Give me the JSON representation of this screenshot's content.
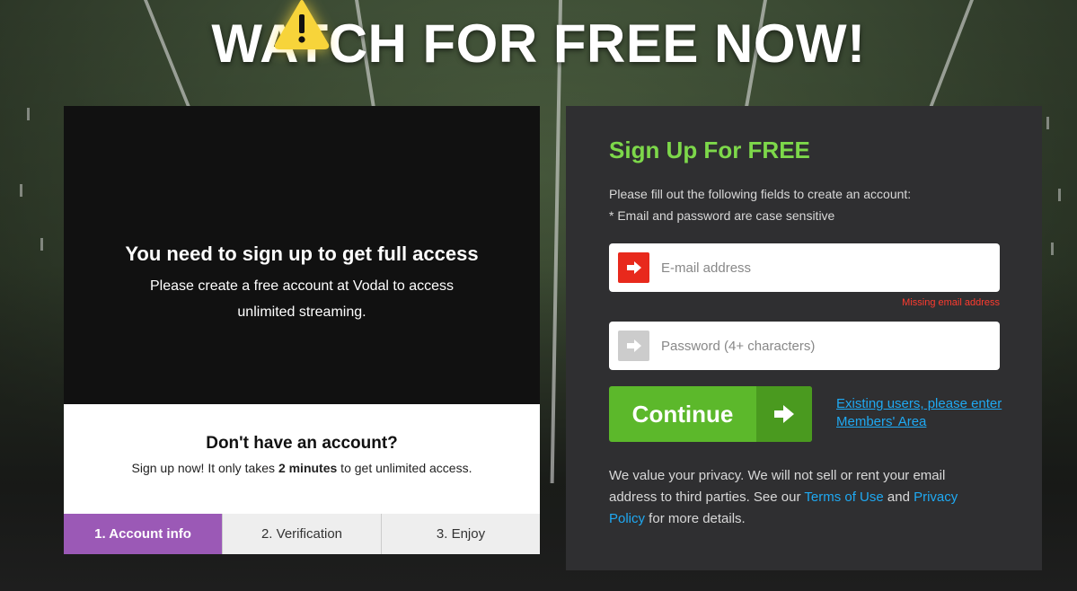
{
  "headline": "WATCH FOR FREE NOW!",
  "left_panel": {
    "warning_title": "You need to sign up to get full access",
    "warning_desc": "Please create a free account at Vodal to access unlimited streaming.",
    "no_account_title": "Don't have an account?",
    "no_account_sub_pre": "Sign up now! It only takes ",
    "no_account_sub_bold": "2 minutes",
    "no_account_sub_post": " to get unlimited access.",
    "steps": [
      "1. Account info",
      "2. Verification",
      "3. Enjoy"
    ],
    "active_step": 0
  },
  "signup": {
    "title": "Sign Up For FREE",
    "info_line1": "Please fill out the following fields to create an account:",
    "info_line2": "* Email and password are case sensitive",
    "email_placeholder": "E-mail address",
    "email_error": "Missing email address",
    "password_placeholder": "Password (4+ characters)",
    "continue_label": "Continue",
    "members_link": "Existing users, please enter Members' Area",
    "privacy_pre": "We value your privacy. We will not sell or rent your email address to third parties. See our ",
    "terms_link": "Terms of Use",
    "privacy_and": " and ",
    "privacy_link": "Privacy Policy",
    "privacy_post": " for more details."
  },
  "colors": {
    "accent_green": "#7dd84a",
    "button_green": "#5cb82b",
    "error_red": "#ff3b2f",
    "link_blue": "#1fa9f2",
    "step_active": "#9b59b6"
  },
  "icons": {
    "warning": "warning-triangle-icon",
    "email_arrow": "arrow-right-icon",
    "password_arrow": "arrow-right-icon",
    "continue_arrow": "arrow-right-icon"
  }
}
